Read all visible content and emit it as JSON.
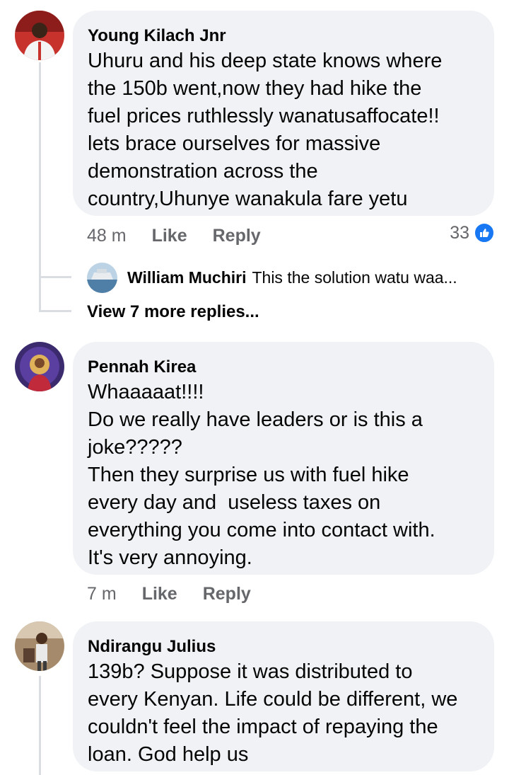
{
  "comments": [
    {
      "author": "Young Kilach Jnr",
      "text": "Uhuru and his deep state knows where\nthe 150b went,now they had hike the\nfuel prices ruthlessly wanatusaffocate!!\nlets brace ourselves for massive\ndemonstration across the\ncountry,Uhunye wanakula fare yetu",
      "time": "48 m",
      "like_label": "Like",
      "reply_label": "Reply",
      "reaction_count": "33",
      "reaction_icon": "thumbs-up-icon",
      "reply_preview": {
        "author": "William Muchiri",
        "snippet": "This the solution watu waa..."
      },
      "view_more": "View 7 more replies..."
    },
    {
      "author": "Pennah Kirea",
      "text": "Whaaaaat!!!!\nDo we really have leaders or is this a\njoke?????\nThen they surprise us with fuel hike\nevery day and  useless taxes on\neverything you come into contact with.\nIt's very annoying.",
      "time": "7 m",
      "like_label": "Like",
      "reply_label": "Reply"
    },
    {
      "author": "Ndirangu Julius",
      "text": "139b? Suppose it was distributed to\nevery Kenyan. Life could be different, we\ncouldn't feel the impact of repaying the\nloan. God help us"
    }
  ],
  "colors": {
    "bubble": "#f0f2f5",
    "action_text": "#65676b",
    "like_blue": "#1877f2",
    "thread_line": "#dadde1"
  }
}
